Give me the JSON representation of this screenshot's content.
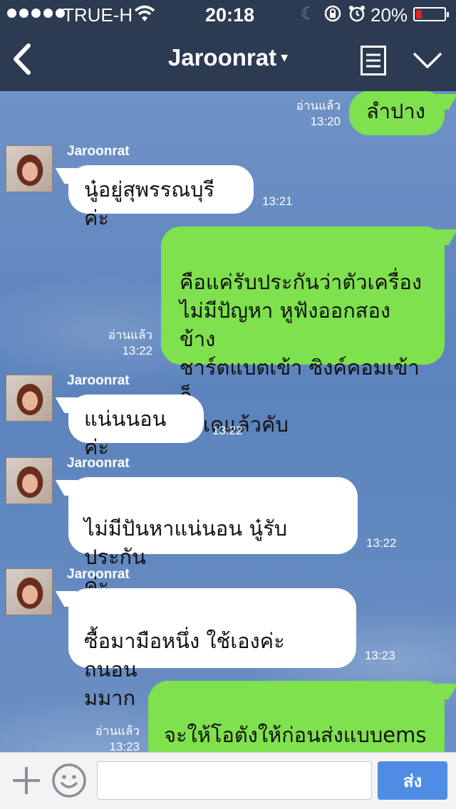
{
  "status_bar": {
    "carrier": "TRUE-H",
    "time": "20:18",
    "battery": "20%",
    "battery_level": 0.2,
    "icons": [
      "signal-dots-icon",
      "wifi-icon",
      "moon-icon",
      "rotation-lock-icon",
      "alarm-icon",
      "battery-icon"
    ]
  },
  "nav": {
    "title": "Jaroonrat",
    "caret": "▾",
    "icons": [
      "back-icon",
      "menu-icon",
      "collapse-icon"
    ]
  },
  "messages": [
    {
      "side": "out",
      "text": "ลำปาง",
      "read": "อ่านแล้ว",
      "time": "13:20"
    },
    {
      "side": "in",
      "sender": "Jaroonrat",
      "text": "นู๋อยู่สุพรรณบุรีค่ะ",
      "time": "13:21"
    },
    {
      "side": "out",
      "text": "คือแค่รับประกันว่าตัวเครื่อง\nไม่มีปัญหา หูฟังออกสองข้าง\nชาร์ตแบตเข้า ซิงค์คอมเข้า ก็\nโอเคแล้วคับ",
      "read": "อ่านแล้ว",
      "time": "13:22"
    },
    {
      "side": "in",
      "sender": "Jaroonrat",
      "text": "แน่นนอนค่ะ",
      "time": "13:22"
    },
    {
      "side": "in",
      "sender": "Jaroonrat",
      "text": "ไม่มีปันหาแน่นอน นู๋รับประกัน\nค่ะ",
      "time": "13:22"
    },
    {
      "side": "in",
      "sender": "Jaroonrat",
      "text": "ซื้อมามือหนึ่ง ใช้เองค่ะ ถนอน\nมมาก",
      "time": "13:23"
    },
    {
      "side": "out",
      "text": "จะให้โอตังให้ก่อนส่งแบบems\nหรือ พกง คับ",
      "read": "อ่านแล้ว",
      "time": "13:23"
    }
  ],
  "input": {
    "placeholder": "",
    "value": "",
    "send_label": "ส่ง"
  },
  "colors": {
    "header": "#2c3a52",
    "outgoing_bubble": "#7ee14d",
    "incoming_bubble": "#ffffff",
    "send_button": "#4f8de5"
  }
}
